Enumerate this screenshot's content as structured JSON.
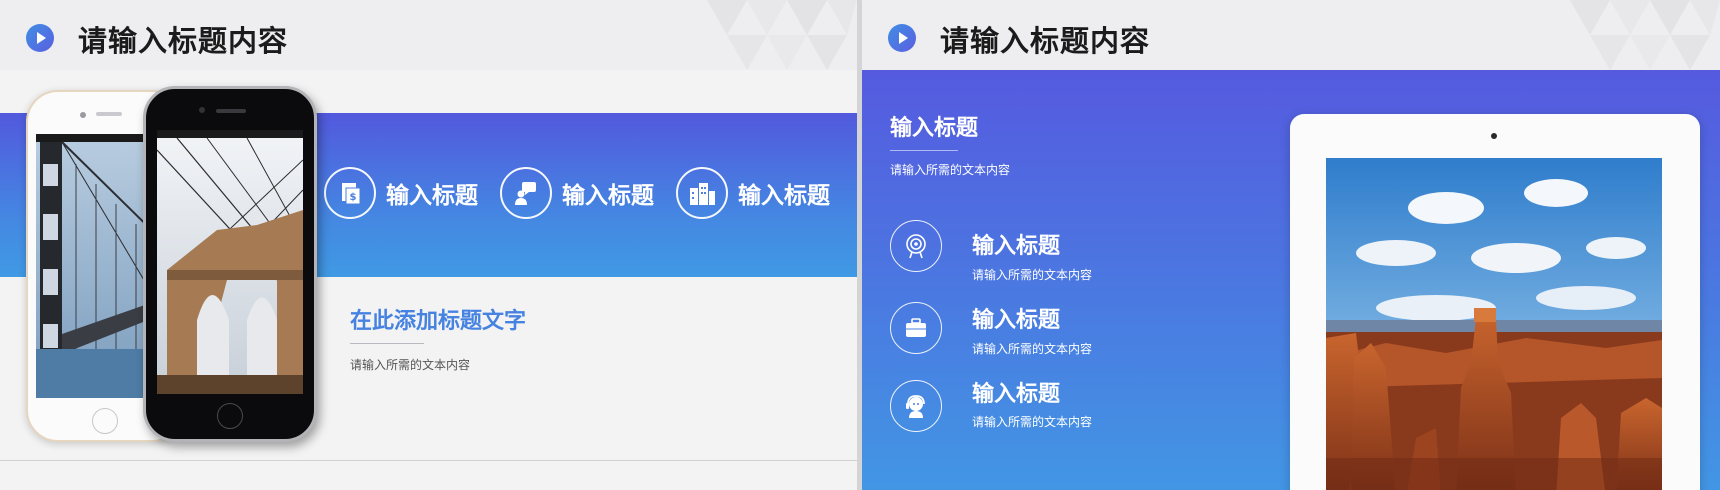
{
  "slide_left": {
    "title": "请输入标题内容",
    "features": [
      {
        "label": "输入标题",
        "icon": "document-dollar-icon"
      },
      {
        "label": "输入标题",
        "icon": "presenter-chat-icon"
      },
      {
        "label": "输入标题",
        "icon": "buildings-icon"
      }
    ],
    "heading": "在此添加标题文字",
    "body": "请输入所需的文本内容",
    "phones": [
      {
        "name": "white-iphone",
        "screen": "bridge-cables-photo"
      },
      {
        "name": "black-iphone",
        "screen": "bridge-tower-photo"
      }
    ]
  },
  "slide_right": {
    "title": "请输入标题内容",
    "panel_title": "输入标题",
    "panel_sub": "请输入所需的文本内容",
    "items": [
      {
        "title": "输入标题",
        "text": "请输入所需的文本内容",
        "icon": "target-icon"
      },
      {
        "title": "输入标题",
        "text": "请输入所需的文本内容",
        "icon": "briefcase-icon"
      },
      {
        "title": "输入标题",
        "text": "请输入所需的文本内容",
        "icon": "headset-icon"
      }
    ],
    "tablet_image": "canyon-landscape-photo"
  },
  "colors": {
    "accent_blue": "#4683e1",
    "gradient_top": "#5259dd",
    "gradient_bottom": "#409ae4",
    "title_text": "#1b1b1b",
    "header_bg": "#eeedef"
  }
}
